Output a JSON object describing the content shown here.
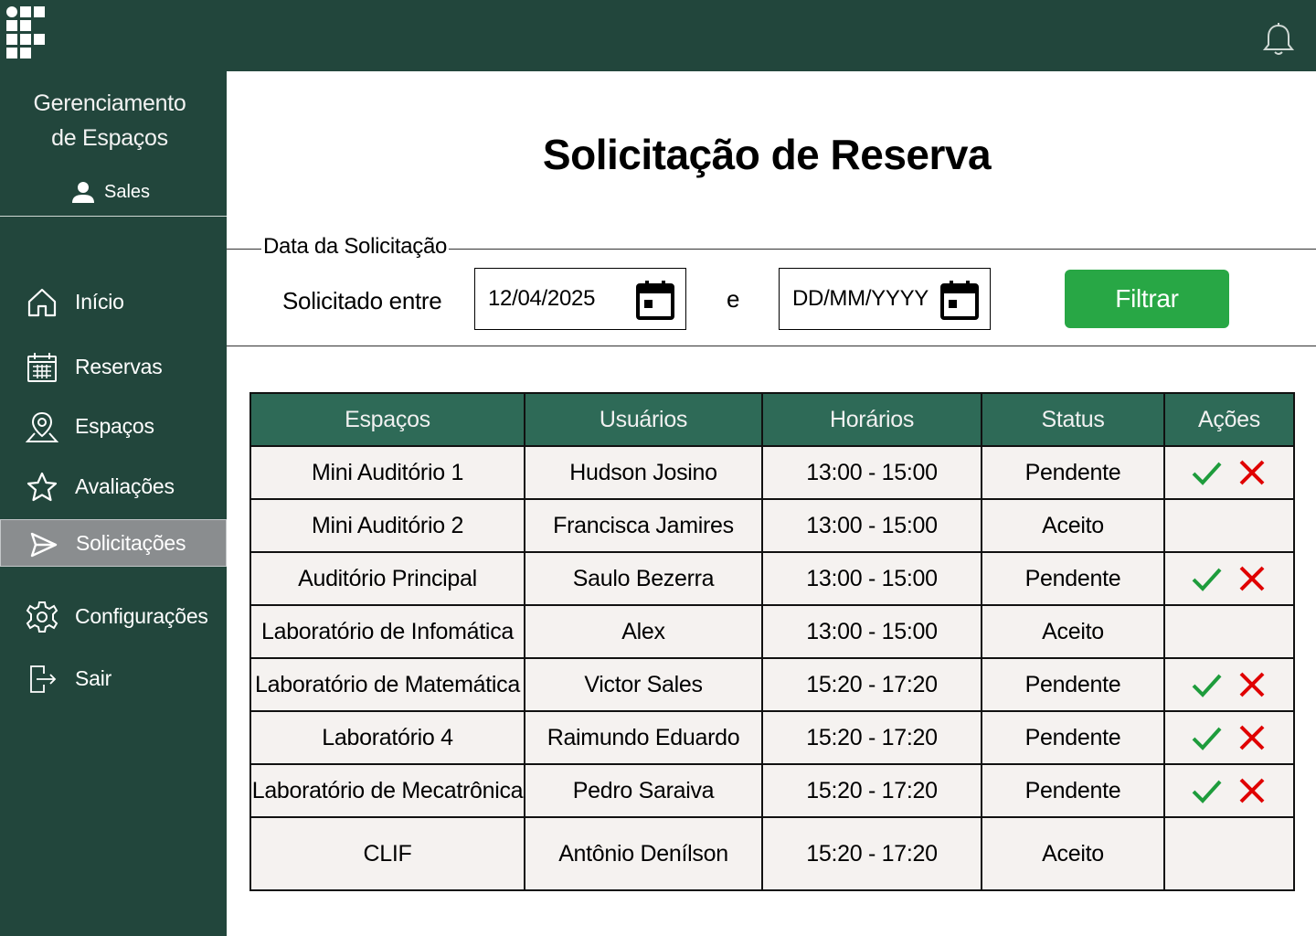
{
  "colors": {
    "sidebar_bg": "#22463c",
    "table_header_bg": "#2e6a57",
    "filter_button_bg": "#28a745",
    "accept_icon": "#1e9c3c",
    "reject_icon": "#e00000",
    "active_nav_bg": "#8a8d8f"
  },
  "header": {
    "logo_icon": "institution-logo",
    "notification_icon": "bell-icon"
  },
  "sidebar": {
    "app_title_line1": "Gerenciamento",
    "app_title_line2": "de Espaços",
    "user_name": "Sales",
    "items": [
      {
        "label": "Início",
        "icon": "home-icon"
      },
      {
        "label": "Reservas",
        "icon": "calendar-icon"
      },
      {
        "label": "Espaços",
        "icon": "map-pin-icon"
      },
      {
        "label": "Avaliações",
        "icon": "star-icon"
      },
      {
        "label": "Solicitações",
        "icon": "send-icon",
        "active": true
      },
      {
        "label": "Configurações",
        "icon": "gear-icon"
      },
      {
        "label": "Sair",
        "icon": "logout-icon"
      }
    ]
  },
  "main": {
    "title": "Solicitação de Reserva",
    "filter": {
      "legend": "Data da Solicitação",
      "range_label": "Solicitado entre",
      "start_date_value": "12/04/2025",
      "end_date_placeholder": "DD/MM/YYYY",
      "conjunction": "e",
      "button_label": "Filtrar"
    },
    "table": {
      "headers": [
        "Espaços",
        "Usuários",
        "Horários",
        "Status",
        "Ações"
      ],
      "rows": [
        {
          "space": "Mini Auditório 1",
          "user": "Hudson Josino",
          "time": "13:00 - 15:00",
          "status": "Pendente"
        },
        {
          "space": "Mini Auditório 2",
          "user": "Francisca Jamires",
          "time": "13:00 - 15:00",
          "status": "Aceito"
        },
        {
          "space": "Auditório Principal",
          "user": "Saulo Bezerra",
          "time": "13:00 - 15:00",
          "status": "Pendente"
        },
        {
          "space": "Laboratório de Infomática",
          "user": "Alex",
          "time": "13:00 - 15:00",
          "status": "Aceito"
        },
        {
          "space": "Laboratório de Matemática",
          "user": "Victor Sales",
          "time": "15:20 - 17:20",
          "status": "Pendente"
        },
        {
          "space": "Laboratório 4",
          "user": "Raimundo Eduardo",
          "time": "15:20 - 17:20",
          "status": "Pendente"
        },
        {
          "space": "Laboratório de Mecatrônica",
          "user": "Pedro Saraiva",
          "time": "15:20 - 17:20",
          "status": "Pendente"
        },
        {
          "space": "CLIF",
          "user": "Antônio Denílson",
          "time": "15:20 - 17:20",
          "status": "Aceito"
        }
      ]
    }
  }
}
